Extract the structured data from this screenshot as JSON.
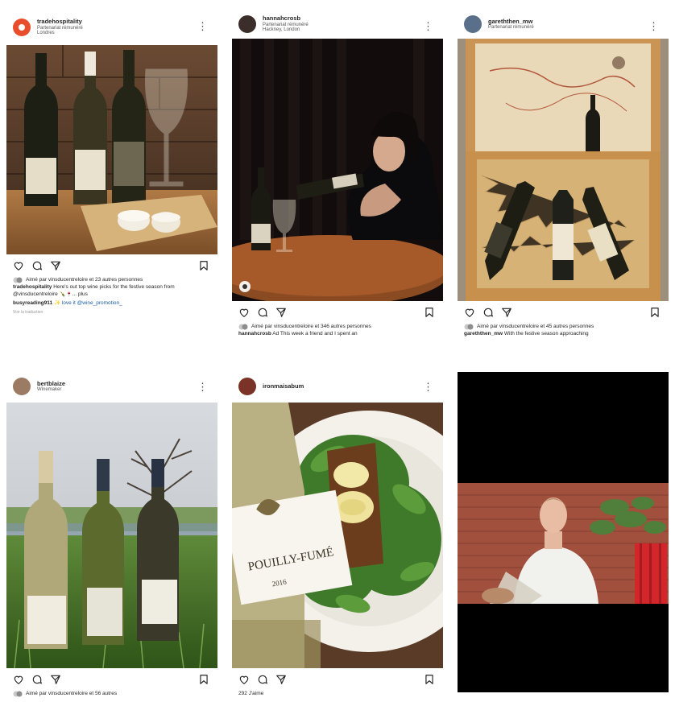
{
  "posts": [
    {
      "username": "tradehospitality",
      "subtitle": "Partenariat rémunéré",
      "location": "Londres",
      "likes": "Aimé par vinsducentreloire et 23 autres personnes",
      "caption_user": "tradehospitality",
      "caption": "Here's out top wine picks for the festive season from @vinsducentreloire 🍾🍷... plus",
      "comment_user": "busyreading911",
      "comment": "✨ love it @wine_promotion_",
      "meta": "Voir la traduction",
      "colors": {
        "avatar": "#e84e2b"
      }
    },
    {
      "username": "hannahcrosb",
      "subtitle": "Partenariat rémunéré",
      "location": "Hackney, London",
      "likes": "Aimé par vinsducentreloire et 346 autres personnes",
      "caption_user": "hannahcrosb",
      "caption": "Ad This week a friend and I spent an",
      "colors": {
        "avatar": "#3b2e2a"
      }
    },
    {
      "username": "gareththen_mw",
      "subtitle": "Partenariat rémunéré",
      "likes": "Aimé par vinsducentreloire et 45 autres personnes",
      "caption_user": "gareththen_mw",
      "caption": "With the festive season approaching",
      "colors": {
        "avatar": "#5a6f8a"
      }
    },
    {
      "username": "bertblaize",
      "subtitle": "Winemaker",
      "likes": "Aimé par vinsducentreloire et 56 autres",
      "colors": {
        "avatar": "#9b7b63"
      }
    },
    {
      "username": "ironmaisabum",
      "likes": "292 J'aime",
      "colors": {
        "avatar": "#7a3326"
      }
    },
    {
      "type": "video"
    }
  ]
}
